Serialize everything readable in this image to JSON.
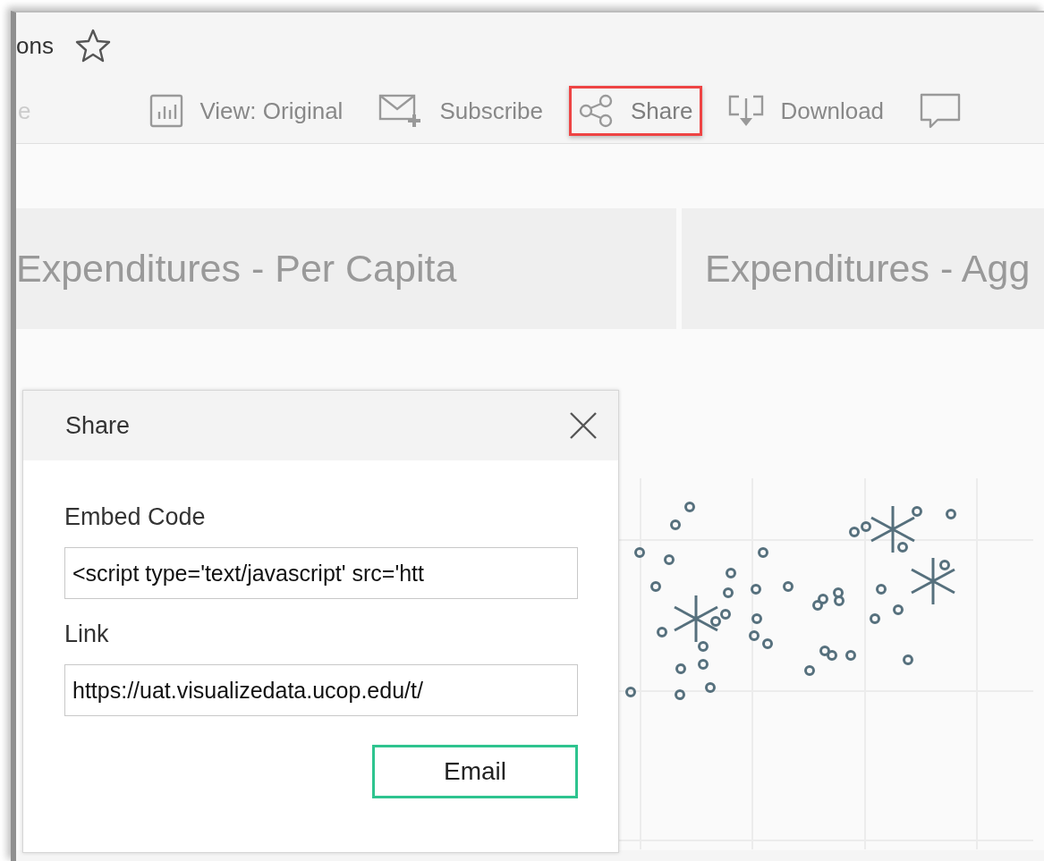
{
  "page": {
    "title": "ons",
    "favorite": false
  },
  "toolbar": [
    {
      "kind": "cut",
      "label": "e"
    },
    {
      "kind": "view",
      "label": "View: Original",
      "highlighted": false
    },
    {
      "kind": "subscribe",
      "label": "Subscribe",
      "highlighted": false
    },
    {
      "kind": "share",
      "label": "Share",
      "highlighted": true
    },
    {
      "kind": "download",
      "label": "Download",
      "highlighted": false
    },
    {
      "kind": "comment",
      "highlighted": false
    }
  ],
  "sheet_tabs": [
    {
      "label": "Expenditures - Per Capita"
    },
    {
      "label": "Expenditures - Agg"
    }
  ],
  "dialog": {
    "title": "Share",
    "fields": [
      {
        "label": "Embed Code",
        "value": "<script type='text/javascript' src='htt"
      },
      {
        "label": "Link",
        "value": "https://uat.visualizedata.ucop.edu/t/"
      }
    ],
    "button": {
      "label": "Email",
      "focused": true
    }
  }
}
